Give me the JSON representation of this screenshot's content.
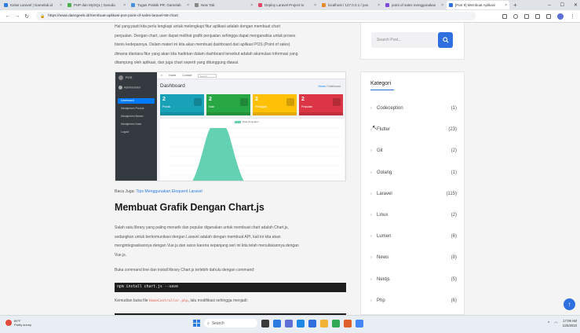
{
  "browser": {
    "tabs": [
      {
        "label": "Kelas Laravel | Gamelab.id",
        "color": "#2e7be0",
        "active": false
      },
      {
        "label": "PHP dan MySQL | Garuda",
        "color": "#4caf50",
        "active": false
      },
      {
        "label": "Tugas Praktik PR: Gamelab",
        "color": "#4a90d9",
        "active": false
      },
      {
        "label": "New Tab",
        "color": "#888888",
        "active": false
      },
      {
        "label": "Deploy Laravel Project to",
        "color": "#e24a6a",
        "active": false
      },
      {
        "label": "localhost / 127.0.0.1 / pos",
        "color": "#f08a24",
        "active": false
      },
      {
        "label": "point of sales menggunakan",
        "color": "#7d4ad9",
        "active": false
      },
      {
        "label": "[Part 9] Membuat Aplikasi",
        "color": "#2f6fe0",
        "active": true
      }
    ],
    "new_tab_glyph": "+",
    "close_glyph": "×",
    "url": "https://www.dasngeeb.id/membuat-aplikasi-pos-point-of-sales-laravel-56-chart"
  },
  "article": {
    "intro_lines": [
      "Hal yang pasti kita perlu lengkapi untuk melengkapi fitur aplikasi adalah dengan membuat chart",
      "penjualan. Dengan chart, user dapat melihat grafik penjualan sehingga dapat menganalisa untuk proses",
      "bisnis kedepannya. Dalam materi ini kita akan membuat dashboard dari aplikasi POS (Point of sales)",
      "dimana diantara fitur yang akan kita hadirkan dalam dashboard tersebut adalah akumulasi informasi yang",
      "ditampung oleh aplikasi, dan juga chart seperti yang ditunggung diawal."
    ],
    "screenshot": {
      "brand": "POS",
      "user": "Administrator",
      "menu": [
        "Dashboard",
        "Manajemen Produk",
        "Manajemen Bahan",
        "Manajemen Kasir",
        "Logout"
      ],
      "topbar": [
        "Home",
        "Contact"
      ],
      "search_placeholder": "Search",
      "title": "Dashboard",
      "breadcrumb_home": "Home",
      "breadcrumb_current": "Dashboard",
      "cards": [
        {
          "value": "2",
          "label": "Produk",
          "color": "#17a2b8"
        },
        {
          "value": "2",
          "label": "Kasir",
          "color": "#28a745"
        },
        {
          "value": "2",
          "label": "Pelanggan",
          "color": "#ffc107"
        },
        {
          "value": "2",
          "label": "Penjualan",
          "color": "#dc3545"
        }
      ],
      "chart_legend": "Data Penjualan",
      "chart_color": "#64d2b2"
    },
    "baca_juga_label": "Baca Juga:",
    "baca_juga_link": "Tips Menggunakan Eloquent Laravel",
    "heading": "Membuat Grafik Dengan Chart.js",
    "section_lines": [
      "Salah satu library yang paling menarik dan popular digunakan untuk membuat chart adalah Chart.js,",
      "sedangkan untuk berkomunikasi dengan Laravel adalah dengan membuat API, kali ini kita akan",
      "mengintegrasikannya dengan Vue.js dan axios karena sepanjang seri ini kita telah menuliskannya dengan",
      "Vue.js."
    ],
    "install_line": "Buka command line dan install library Chart.js terlebih dahulu dengan command:",
    "code": "npm install chart.js --save",
    "modify_prefix": "Kemudian buka file",
    "modify_file": "HomeController.php",
    "modify_suffix": ", lalu modifikasi sehingga menjadi:"
  },
  "sidebar": {
    "search_placeholder": "Search Post...",
    "kategori_title": "Kategori",
    "categories": [
      {
        "name": "Codeception",
        "count": "(1)"
      },
      {
        "name": "Flutter",
        "count": "(23)"
      },
      {
        "name": "Git",
        "count": "(2)"
      },
      {
        "name": "Golang",
        "count": "(1)"
      },
      {
        "name": "Laravel",
        "count": "(115)"
      },
      {
        "name": "Linux",
        "count": "(2)"
      },
      {
        "name": "Lumen",
        "count": "(6)"
      },
      {
        "name": "News",
        "count": "(8)"
      },
      {
        "name": "Nextjs",
        "count": "(5)"
      },
      {
        "name": "Php",
        "count": "(6)"
      }
    ]
  },
  "taskbar": {
    "temp": "89°F",
    "weather": "Partly sunny",
    "search": "Search",
    "time": "17:08 AM",
    "date": "11/5/2023"
  }
}
